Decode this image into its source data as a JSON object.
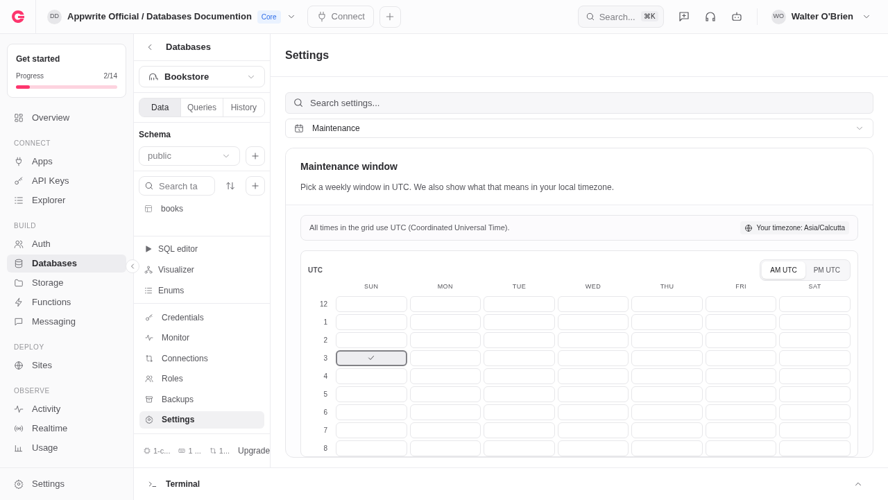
{
  "topbar": {
    "avatar": "DD",
    "project": "Appwrite Official / Databases Documention",
    "plan": "Core",
    "connect": "Connect",
    "search": {
      "placeholder": "Search...",
      "shortcut": "⌘K"
    },
    "user": {
      "initials": "WO",
      "name": "Walter O'Brien"
    }
  },
  "get_started": {
    "title": "Get started",
    "label": "Progress",
    "count": "2/14",
    "level": 0.14
  },
  "sidebar": {
    "items": [
      {
        "kind": "item",
        "label": "Overview",
        "selected": false
      },
      {
        "kind": "section",
        "label": "CONNECT"
      },
      {
        "kind": "item",
        "label": "Apps",
        "selected": false
      },
      {
        "kind": "item",
        "label": "API Keys",
        "selected": false
      },
      {
        "kind": "item",
        "label": "Explorer",
        "selected": false
      },
      {
        "kind": "section",
        "label": "BUILD"
      },
      {
        "kind": "item",
        "label": "Auth",
        "selected": false
      },
      {
        "kind": "item",
        "label": "Databases",
        "selected": true
      },
      {
        "kind": "item",
        "label": "Storage",
        "selected": false
      },
      {
        "kind": "item",
        "label": "Functions",
        "selected": false
      },
      {
        "kind": "item",
        "label": "Messaging",
        "selected": false
      },
      {
        "kind": "section",
        "label": "DEPLOY"
      },
      {
        "kind": "item",
        "label": "Sites",
        "selected": false
      },
      {
        "kind": "section",
        "label": "OBSERVE"
      },
      {
        "kind": "item",
        "label": "Activity",
        "selected": false
      },
      {
        "kind": "item",
        "label": "Realtime",
        "selected": false
      },
      {
        "kind": "item",
        "label": "Usage",
        "selected": false
      }
    ],
    "footer": {
      "label": "Settings"
    }
  },
  "db_panel": {
    "back_title": "Databases",
    "database": "Bookstore",
    "tabs": [
      {
        "label": "Data",
        "selected": true
      },
      {
        "label": "Queries",
        "selected": false
      },
      {
        "label": "History",
        "selected": false
      }
    ],
    "schema_label": "Schema",
    "schema": "public",
    "table_search": {
      "placeholder": "Search ta"
    },
    "tables": [
      {
        "label": "books"
      }
    ],
    "tools": [
      {
        "label": "SQL editor"
      },
      {
        "label": "Visualizer"
      },
      {
        "label": "Enums"
      }
    ],
    "menu": [
      {
        "label": "Credentials",
        "selected": false
      },
      {
        "label": "Monitor",
        "selected": false
      },
      {
        "label": "Connections",
        "selected": false
      },
      {
        "label": "Roles",
        "selected": false
      },
      {
        "label": "Backups",
        "selected": false
      },
      {
        "label": "Settings",
        "selected": true
      }
    ],
    "footer": [
      "1-c...",
      "1 ...",
      "1..."
    ],
    "upgrade": "Upgrade"
  },
  "settings": {
    "title": "Settings",
    "search": {
      "placeholder": "Search settings..."
    },
    "section": "Maintenance",
    "card": {
      "title": "Maintenance window",
      "description": "Pick a weekly window in UTC. We also show what that means in your local timezone.",
      "note": "All times in the grid use UTC (Coordinated Universal Time).",
      "timezone": "Your timezone: Asia/Calcutta",
      "grid_label": "UTC",
      "toggle": [
        {
          "label": "AM UTC",
          "selected": true
        },
        {
          "label": "PM UTC",
          "selected": false
        }
      ],
      "days": [
        "SUN",
        "MON",
        "TUE",
        "WED",
        "THU",
        "FRI",
        "SAT"
      ],
      "rows": [
        {
          "hour": "12",
          "cells": [
            false,
            false,
            false,
            false,
            false,
            false,
            false
          ]
        },
        {
          "hour": "1",
          "cells": [
            false,
            false,
            false,
            false,
            false,
            false,
            false
          ]
        },
        {
          "hour": "2",
          "cells": [
            false,
            false,
            false,
            false,
            false,
            false,
            false
          ]
        },
        {
          "hour": "3",
          "cells": [
            true,
            false,
            false,
            false,
            false,
            false,
            false
          ]
        },
        {
          "hour": "4",
          "cells": [
            false,
            false,
            false,
            false,
            false,
            false,
            false
          ]
        },
        {
          "hour": "5",
          "cells": [
            false,
            false,
            false,
            false,
            false,
            false,
            false
          ]
        },
        {
          "hour": "6",
          "cells": [
            false,
            false,
            false,
            false,
            false,
            false,
            false
          ]
        },
        {
          "hour": "7",
          "cells": [
            false,
            false,
            false,
            false,
            false,
            false,
            false
          ]
        },
        {
          "hour": "8",
          "cells": [
            false,
            false,
            false,
            false,
            false,
            false,
            false
          ]
        }
      ]
    }
  },
  "terminal": {
    "label": "Terminal"
  }
}
